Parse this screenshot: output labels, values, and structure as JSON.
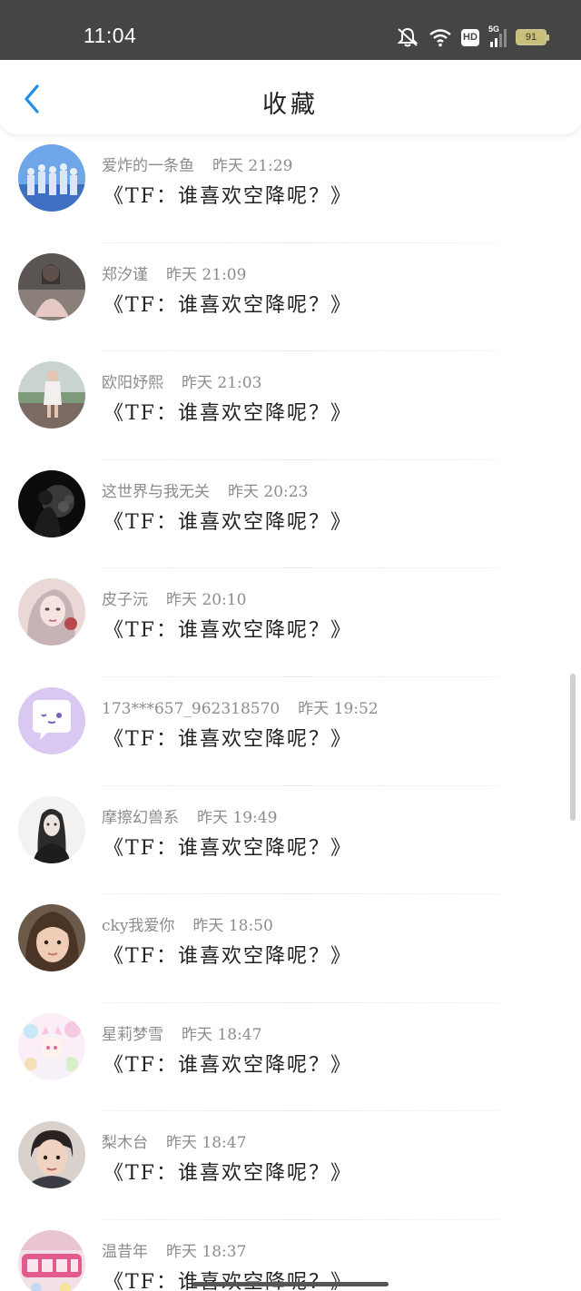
{
  "status_bar": {
    "time": "11:04",
    "network": "5G",
    "hd": "HD",
    "battery": "91"
  },
  "header": {
    "title": "收藏"
  },
  "items": [
    {
      "user": "爱炸的一条鱼",
      "time": "昨天 21:29",
      "title": "《TF：谁喜欢空降呢？》",
      "avatar": "avatar-group"
    },
    {
      "user": "郑汐谨",
      "time": "昨天 21:09",
      "title": "《TF：谁喜欢空降呢？》",
      "avatar": "avatar-dress"
    },
    {
      "user": "欧阳妤熙",
      "time": "昨天 21:03",
      "title": "《TF：谁喜欢空降呢？》",
      "avatar": "avatar-girl-field"
    },
    {
      "user": "这世界与我无关",
      "time": "昨天 20:23",
      "title": "《TF：谁喜欢空降呢？》",
      "avatar": "avatar-silhouette"
    },
    {
      "user": "皮子沅",
      "time": "昨天 20:10",
      "title": "《TF：谁喜欢空降呢？》",
      "avatar": "avatar-drawing"
    },
    {
      "user": "173***657_962318570",
      "time": "昨天 19:52",
      "title": "《TF：谁喜欢空降呢？》",
      "avatar": "avatar-default-chat"
    },
    {
      "user": "摩擦幻兽系",
      "time": "昨天 19:49",
      "title": "《TF：谁喜欢空降呢？》",
      "avatar": "avatar-anime-dark"
    },
    {
      "user": "cky我爱你",
      "time": "昨天 18:50",
      "title": "《TF：谁喜欢空降呢？》",
      "avatar": "avatar-child"
    },
    {
      "user": "星莉梦雪",
      "time": "昨天 18:47",
      "title": "《TF：谁喜欢空降呢？》",
      "avatar": "avatar-pastel"
    },
    {
      "user": "梨木台",
      "time": "昨天 18:47",
      "title": "《TF：谁喜欢空降呢？》",
      "avatar": "avatar-boy"
    },
    {
      "user": "温昔年",
      "time": "昨天 18:37",
      "title": "《TF：谁喜欢空降呢？》",
      "avatar": "avatar-text-art"
    }
  ],
  "colors": {
    "accent": "#1e8fe8",
    "status_bar": "#454545",
    "meta_text": "#8c8c8c"
  }
}
